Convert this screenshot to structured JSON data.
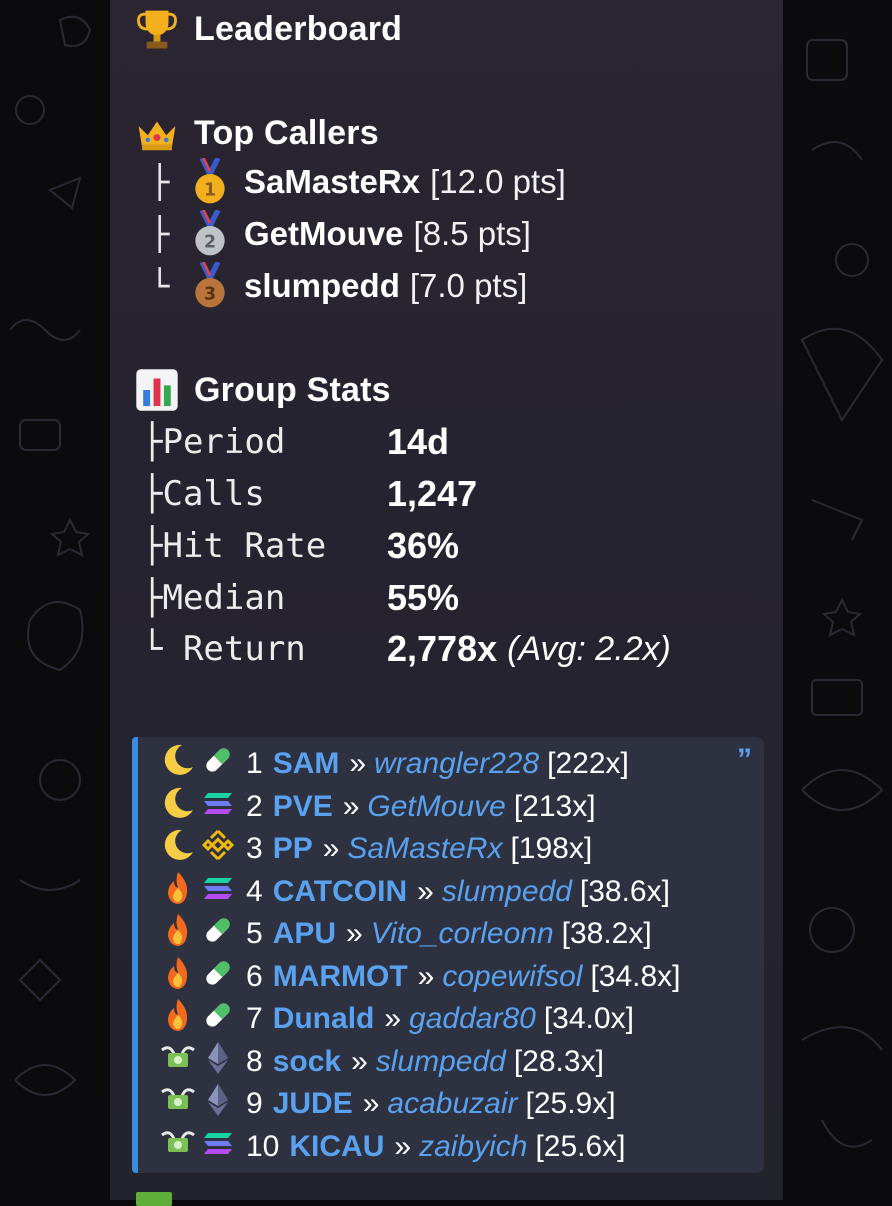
{
  "leaderboard": {
    "title": "Leaderboard",
    "icon": "trophy-icon"
  },
  "top_callers": {
    "title": "Top Callers",
    "icon": "crown-icon",
    "items": [
      {
        "tree": "├",
        "medal": "gold-medal-icon",
        "name": "SaMasteRx",
        "pts": "[12.0 pts]"
      },
      {
        "tree": "├",
        "medal": "silver-medal-icon",
        "name": "GetMouve",
        "pts": "[8.5 pts]"
      },
      {
        "tree": "└",
        "medal": "bronze-medal-icon",
        "name": "slumpedd",
        "pts": "[7.0 pts]"
      }
    ]
  },
  "group_stats": {
    "title": "Group Stats",
    "icon": "bar-chart-icon",
    "items": [
      {
        "label": "├Period",
        "value": "14d"
      },
      {
        "label": "├Calls",
        "value": "1,247"
      },
      {
        "label": "├Hit Rate",
        "value": "36%"
      },
      {
        "label": "├Median",
        "value": "55%"
      },
      {
        "label": "└ Return",
        "value": "2,778x",
        "extra": "(Avg: 2.2x)"
      }
    ]
  },
  "calls": [
    {
      "status": "moon-icon",
      "chain": "pill-icon",
      "rank": "1",
      "token": "SAM",
      "sep": "»",
      "user": "wrangler228",
      "mult": "[222x]"
    },
    {
      "status": "moon-icon",
      "chain": "solana-icon",
      "rank": "2",
      "token": "PVE",
      "sep": "»",
      "user": "GetMouve",
      "mult": "[213x]"
    },
    {
      "status": "moon-icon",
      "chain": "bnb-icon",
      "rank": "3",
      "token": "PP",
      "sep": "»",
      "user": "SaMasteRx",
      "mult": "[198x]"
    },
    {
      "status": "fire-icon",
      "chain": "solana-icon",
      "rank": "4",
      "token": "CATCOIN",
      "sep": "»",
      "user": "slumpedd",
      "mult": "[38.6x]"
    },
    {
      "status": "fire-icon",
      "chain": "pill-icon",
      "rank": "5",
      "token": "APU",
      "sep": "»",
      "user": "Vito_corleonn",
      "mult": "[38.2x]"
    },
    {
      "status": "fire-icon",
      "chain": "pill-icon",
      "rank": "6",
      "token": "MARMOT",
      "sep": "»",
      "user": "copewifsol",
      "mult": "[34.8x]"
    },
    {
      "status": "fire-icon",
      "chain": "pill-icon",
      "rank": "7",
      "token": "Dunald",
      "sep": "»",
      "user": "gaddar80",
      "mult": "[34.0x]"
    },
    {
      "status": "money-wings-icon",
      "chain": "ethereum-icon",
      "rank": "8",
      "token": "sock",
      "sep": "»",
      "user": "slumpedd",
      "mult": "[28.3x]"
    },
    {
      "status": "money-wings-icon",
      "chain": "ethereum-icon",
      "rank": "9",
      "token": "JUDE",
      "sep": "»",
      "user": "acabuzair",
      "mult": "[25.9x]"
    },
    {
      "status": "money-wings-icon",
      "chain": "solana-icon",
      "rank": "10",
      "token": "KICAU",
      "sep": "»",
      "user": "zaibyich",
      "mult": "[25.6x]"
    }
  ],
  "colors": {
    "accent": "#5aa2f0",
    "quote_bar": "#3d8be0",
    "bubble": "#262330",
    "background": "#0b0b0d"
  }
}
